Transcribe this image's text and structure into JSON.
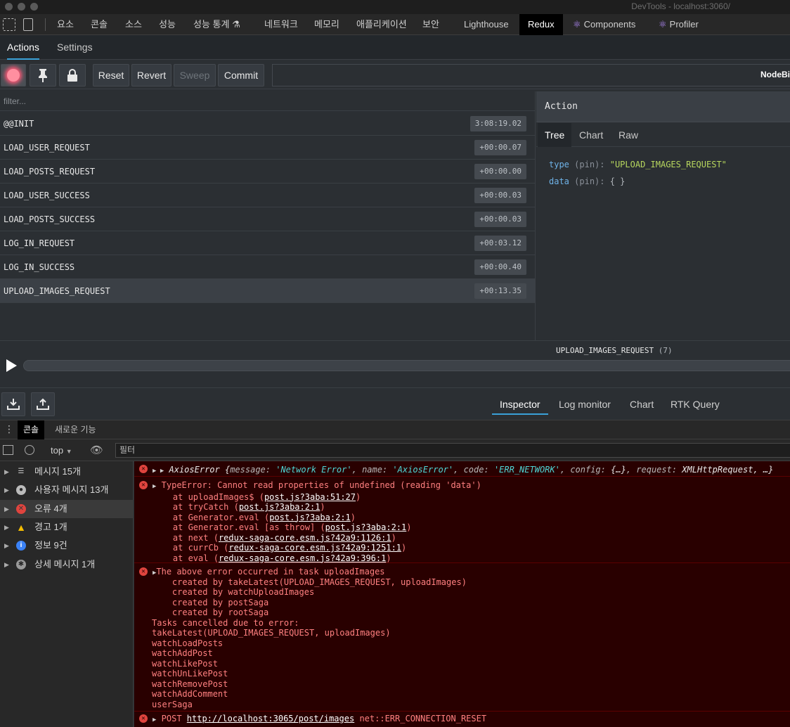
{
  "window": {
    "title": "DevTools - localhost:3060/"
  },
  "devtools_tabs": [
    {
      "label": "요소"
    },
    {
      "label": "콘솔"
    },
    {
      "label": "소스"
    },
    {
      "label": "성능"
    },
    {
      "label": "성능 통계 ⚗"
    },
    {
      "label": "네트워크"
    },
    {
      "label": "메모리"
    },
    {
      "label": "애플리케이션"
    },
    {
      "label": "보안"
    },
    {
      "label": "Lighthouse"
    },
    {
      "label": "Redux"
    },
    {
      "label": "Components"
    },
    {
      "label": "Profiler"
    }
  ],
  "redux": {
    "tabs": {
      "actions": "Actions",
      "settings": "Settings"
    },
    "toolbar": {
      "reset": "Reset",
      "revert": "Revert",
      "sweep": "Sweep",
      "commit": "Commit",
      "instance": "NodeBi"
    },
    "filter_placeholder": "filter...",
    "actions": [
      {
        "name": "@@INIT",
        "time": "3:08:19.02"
      },
      {
        "name": "LOAD_USER_REQUEST",
        "time": "+00:00.07"
      },
      {
        "name": "LOAD_POSTS_REQUEST",
        "time": "+00:00.00"
      },
      {
        "name": "LOAD_USER_SUCCESS",
        "time": "+00:00.03"
      },
      {
        "name": "LOAD_POSTS_SUCCESS",
        "time": "+00:00.03"
      },
      {
        "name": "LOG_IN_REQUEST",
        "time": "+00:03.12"
      },
      {
        "name": "LOG_IN_SUCCESS",
        "time": "+00:00.40"
      },
      {
        "name": "UPLOAD_IMAGES_REQUEST",
        "time": "+00:13.35"
      }
    ],
    "detail": {
      "header": "Action",
      "tabs": {
        "tree": "Tree",
        "chart": "Chart",
        "raw": "Raw"
      },
      "tree": [
        {
          "key": "type",
          "pin": "(pin):",
          "value": "\"UPLOAD_IMAGES_REQUEST\""
        },
        {
          "key": "data",
          "pin": "(pin):",
          "value": "{ }"
        }
      ]
    },
    "slider": {
      "label": "UPLOAD_IMAGES_REQUEST",
      "count": "(7)"
    },
    "monitors": {
      "inspector": "Inspector",
      "log": "Log monitor",
      "chart": "Chart",
      "rtk": "RTK Query"
    }
  },
  "drawer": {
    "tabs": {
      "console": "콘솔",
      "whats_new": "새로운 기능"
    },
    "context": "top",
    "filter_placeholder": "필터",
    "sidebar": [
      {
        "label": "메시지 15개",
        "icon": "list-icon"
      },
      {
        "label": "사용자 메시지 13개",
        "icon": "user-icon"
      },
      {
        "label": "오류 4개",
        "icon": "error-icon"
      },
      {
        "label": "경고 1개",
        "icon": "warning-icon"
      },
      {
        "label": "정보 9건",
        "icon": "info-icon"
      },
      {
        "label": "상세 메시지 1개",
        "icon": "bug-icon"
      }
    ],
    "axios": {
      "name": "AxiosError",
      "k_message": "message",
      "v_message": "'Network Error'",
      "k_name": "name",
      "v_name": "'AxiosError'",
      "k_code": "code",
      "v_code": "'ERR_NETWORK'",
      "k_config": "config",
      "v_config": "{…}",
      "k_request": "request",
      "v_request": "XMLHttpRequest, …"
    },
    "typeerror": {
      "head": "TypeError: Cannot read properties of undefined (reading 'data')",
      "frames": [
        {
          "fn": "at uploadImages$ (",
          "src": "post.js?3aba:51:27",
          "end": ")"
        },
        {
          "fn": "at tryCatch (",
          "src": "post.js?3aba:2:1",
          "end": ")"
        },
        {
          "fn": "at Generator.eval (",
          "src": "post.js?3aba:2:1",
          "end": ")"
        },
        {
          "fn": "at Generator.eval [as throw] (",
          "src": "post.js?3aba:2:1",
          "end": ")"
        },
        {
          "fn": "at next (",
          "src": "redux-saga-core.esm.js?42a9:1126:1",
          "end": ")"
        },
        {
          "fn": "at currCb (",
          "src": "redux-saga-core.esm.js?42a9:1251:1",
          "end": ")"
        },
        {
          "fn": "at eval (",
          "src": "redux-saga-core.esm.js?42a9:396:1",
          "end": ")"
        }
      ]
    },
    "saga": {
      "head": "The above error occurred in task uploadImages",
      "lines": [
        "    created by takeLatest(UPLOAD_IMAGES_REQUEST, uploadImages)",
        "    created by watchUploadImages",
        "    created by postSaga",
        "    created by rootSaga",
        "Tasks cancelled due to error:",
        "takeLatest(UPLOAD_IMAGES_REQUEST, uploadImages)",
        "watchLoadPosts",
        "watchAddPost",
        "watchLikePost",
        "watchUnLikePost",
        "watchRemovePost",
        "watchAddComment",
        "userSaga"
      ]
    },
    "post": {
      "method": "POST",
      "url": "http://localhost:3065/post/images",
      "status": "net::ERR_CONNECTION_RESET"
    }
  }
}
